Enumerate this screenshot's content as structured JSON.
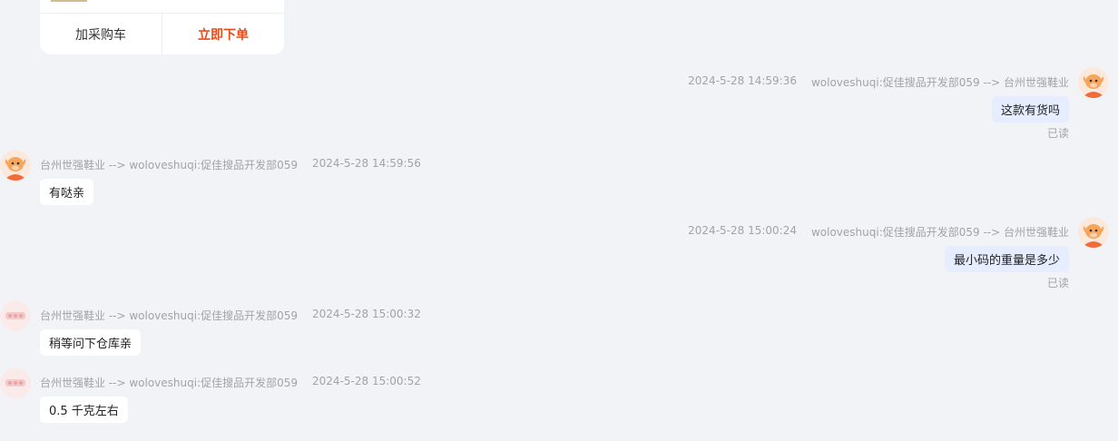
{
  "product_card": {
    "add_to_cart_label": "加采购车",
    "order_now_label": "立即下单"
  },
  "messages": [
    {
      "side": "right",
      "sender": "woloveshuqi:促佳搜品开发部059 --> 台州世强鞋业",
      "time": "2024-5-28 14:59:36",
      "text": "这款有货吗",
      "status": "已读",
      "avatar": "mascot-avatar"
    },
    {
      "side": "left",
      "sender": "台州世强鞋业 --> woloveshuqi:促佳搜品开发部059",
      "time": "2024-5-28 14:59:56",
      "text": "有哒亲",
      "avatar": "mascot-avatar"
    },
    {
      "side": "right",
      "sender": "woloveshuqi:促佳搜品开发部059 --> 台州世强鞋业",
      "time": "2024-5-28 15:00:24",
      "text": "最小码的重量是多少",
      "status": "已读",
      "avatar": "mascot-avatar"
    },
    {
      "side": "left",
      "sender": "台州世强鞋业 --> woloveshuqi:促佳搜品开发部059",
      "time": "2024-5-28 15:00:32",
      "text": "稍等问下仓库亲",
      "avatar": "shop-logo-avatar"
    },
    {
      "side": "left",
      "sender": "台州世强鞋业 --> woloveshuqi:促佳搜品开发部059",
      "time": "2024-5-28 15:00:52",
      "text": "0.5 千克左右",
      "avatar": "shop-logo-avatar"
    }
  ]
}
